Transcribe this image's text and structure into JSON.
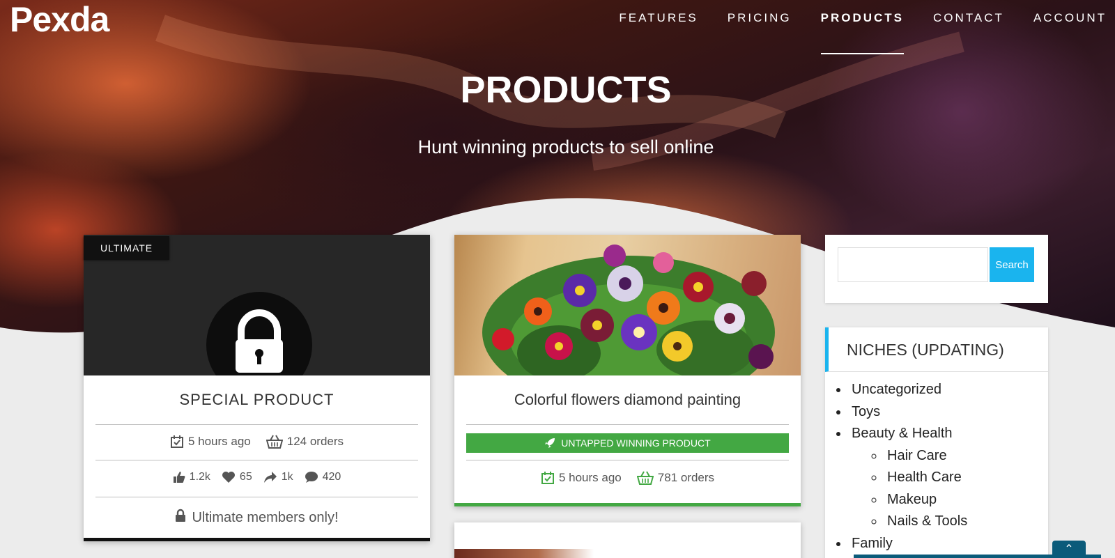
{
  "brand": {
    "logo": "Pexda"
  },
  "nav": {
    "items": [
      {
        "label": "FEATURES",
        "active": false
      },
      {
        "label": "PRICING",
        "active": false
      },
      {
        "label": "PRODUCTS",
        "active": true
      },
      {
        "label": "CONTACT",
        "active": false
      },
      {
        "label": "ACCOUNT",
        "active": false
      }
    ]
  },
  "hero": {
    "title": "PRODUCTS",
    "subtitle": "Hunt winning products to sell online"
  },
  "cards": [
    {
      "badge": "ULTIMATE",
      "title": "SPECIAL PRODUCT",
      "time": "5 hours ago",
      "orders": "124 orders",
      "likes": "1.2k",
      "hearts": "65",
      "shares": "1k",
      "comments": "420",
      "locked_text": "Ultimate members only!"
    },
    {
      "title": "Colorful flowers diamond painting",
      "tag": "UNTAPPED WINNING PRODUCT",
      "time": "5 hours ago",
      "orders": "781 orders"
    }
  ],
  "sidebar": {
    "search": {
      "placeholder": "",
      "button_label": "Search"
    },
    "niches": {
      "heading": "NICHES (UPDATING)",
      "items": [
        "Uncategorized",
        "Toys",
        "Beauty & Health",
        "Hair Care",
        "Health Care",
        "Makeup",
        "Nails & Tools",
        "Family"
      ]
    }
  },
  "colors": {
    "accent_blue": "#1ab4ee",
    "success_green": "#43a843",
    "dark_footer": "#0b5b7a"
  },
  "icons": {
    "back_to_top": "chevron-up-icon"
  }
}
